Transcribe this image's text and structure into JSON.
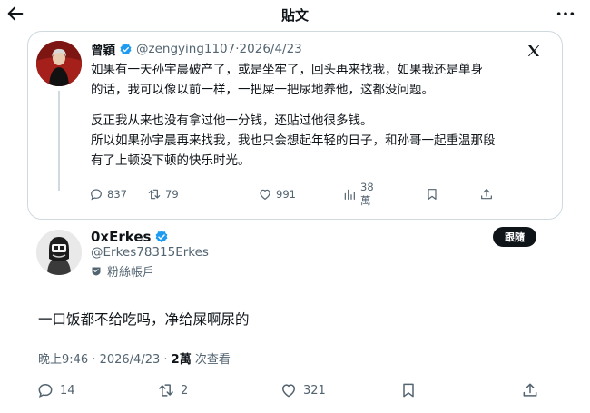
{
  "header": {
    "title": "貼文"
  },
  "quoted": {
    "name": "曾穎",
    "handle": "@zengying1107",
    "sep": "·",
    "date": "2026/4/23",
    "lines": [
      "如果有一天孙宇晨破产了，或是坐牢了，回头再来找我，如果我还是单身",
      "的话，我可以像以前一样，一把屎一把尿地养他，这都没问题。",
      "反正我从来也没有拿过他一分钱，还贴过他很多钱。",
      "所以如果孙宇晨再来找我，我也只会想起年轻的日子，和孙哥一起重温那段",
      "有了上顿没下顿的快乐时光。"
    ],
    "stats": {
      "replies": "837",
      "reposts": "79",
      "likes": "991",
      "views": "38萬"
    }
  },
  "tweet": {
    "name": "0xErkes",
    "handle": "@Erkes78315Erkes",
    "fan_label": "粉絲帳戶",
    "follow_label": "跟隨",
    "text": "一口饭都不给吃吗，净给屎啊尿的",
    "time": "晚上9:46 · 2026/4/23 · ",
    "views_count": "2萬",
    "views_label": " 次查看",
    "stats": {
      "replies": "14",
      "reposts": "2",
      "likes": "321"
    }
  },
  "colors": {
    "text": "#0f1419",
    "secondary": "#536471",
    "verified": "#1d9bf0",
    "border": "#cfd9de"
  }
}
